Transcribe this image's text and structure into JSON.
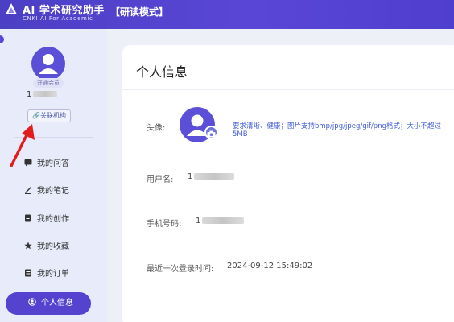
{
  "header": {
    "title": "AI 学术研究助手",
    "subtitle": "CNKI AI For Academic",
    "mode": "【研读模式】",
    "accent": "#4b3fc4"
  },
  "sidebar": {
    "badge": "开通会员",
    "username": "1",
    "link_org": "关联机构",
    "items": [
      {
        "label": "我的问答",
        "icon": "chat-icon"
      },
      {
        "label": "我的笔记",
        "icon": "pen-icon"
      },
      {
        "label": "我的创作",
        "icon": "edit-doc-icon"
      },
      {
        "label": "我的收藏",
        "icon": "star-icon"
      },
      {
        "label": "我的订单",
        "icon": "order-icon"
      },
      {
        "label": "个人信息",
        "icon": "user-circle-icon",
        "active": true
      }
    ]
  },
  "profile": {
    "title": "个人信息",
    "avatar_label": "头像:",
    "avatar_hint": "要求清晰、健康；图片支持bmp/jpg/jpeg/gif/png格式；大小不超过5MB",
    "username_label": "用户名:",
    "username_value": "1",
    "phone_label": "手机号码:",
    "phone_value": "1",
    "last_login_label": "最近一次登录时间:",
    "last_login_value": "2024-09-12 15:49:02"
  }
}
